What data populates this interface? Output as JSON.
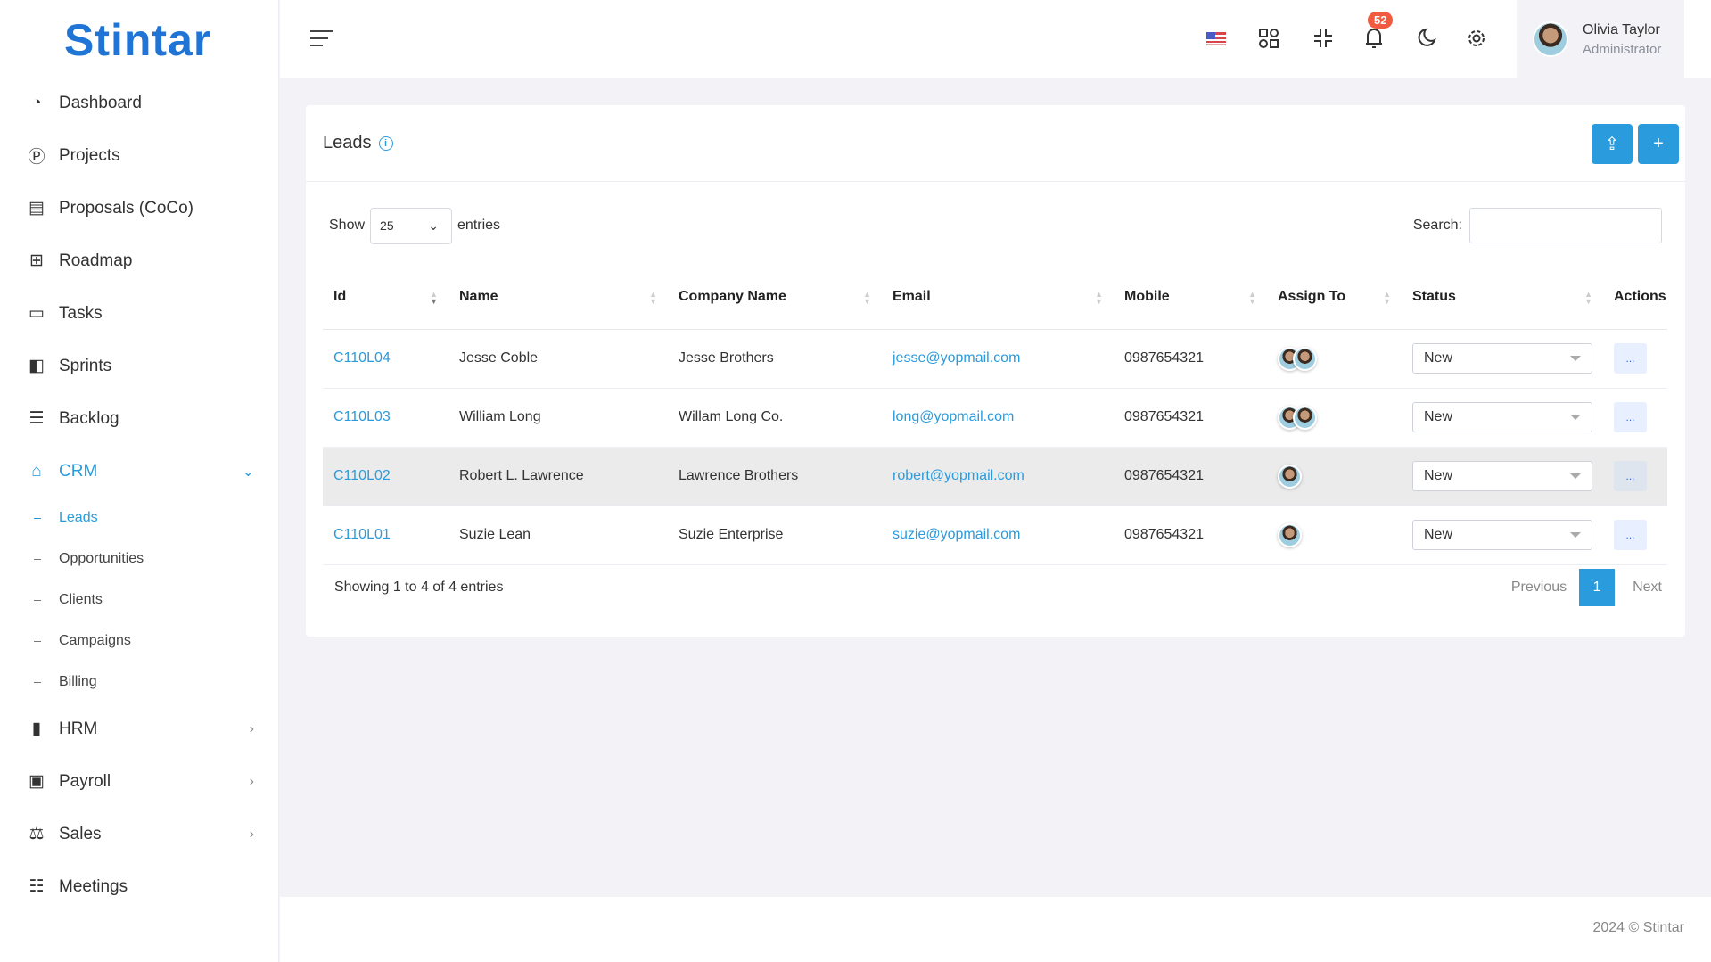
{
  "brand": {
    "name": "Stintar",
    "accent": "#2a9bdc"
  },
  "sidebar": {
    "items": [
      {
        "label": "Dashboard",
        "icon": "gauge-icon"
      },
      {
        "label": "Projects",
        "icon": "p-circle-icon"
      },
      {
        "label": "Proposals (CoCo)",
        "icon": "layout-icon"
      },
      {
        "label": "Roadmap",
        "icon": "sitemap-icon"
      },
      {
        "label": "Tasks",
        "icon": "ticket-icon"
      },
      {
        "label": "Sprints",
        "icon": "board-icon"
      },
      {
        "label": "Backlog",
        "icon": "list-check-icon"
      },
      {
        "label": "CRM",
        "icon": "crm-icon",
        "active": true,
        "expanded": true
      }
    ],
    "crm_sub": [
      "Leads",
      "Opportunities",
      "Clients",
      "Campaigns",
      "Billing"
    ],
    "items_after": [
      {
        "label": "HRM",
        "icon": "hrm-icon"
      },
      {
        "label": "Payroll",
        "icon": "payroll-icon"
      },
      {
        "label": "Sales",
        "icon": "scale-icon"
      },
      {
        "label": "Meetings",
        "icon": "people-icon"
      }
    ]
  },
  "header": {
    "notifications": "52",
    "user": {
      "name": "Olivia Taylor",
      "role": "Administrator"
    }
  },
  "card": {
    "title": "Leads",
    "show": "Show",
    "entries": "entries",
    "page_size": "25",
    "search_label": "Search:",
    "search_value": "",
    "columns": [
      "Id",
      "Name",
      "Company Name",
      "Email",
      "Mobile",
      "Assign To",
      "Status",
      "Actions"
    ],
    "rows": [
      {
        "id": "C110L04",
        "name": "Jesse Coble",
        "company": "Jesse Brothers",
        "email": "jesse@yopmail.com",
        "mobile": "0987654321",
        "assignees": 2,
        "status": "New"
      },
      {
        "id": "C110L03",
        "name": "William Long",
        "company": "Willam Long Co.",
        "email": "long@yopmail.com",
        "mobile": "0987654321",
        "assignees": 2,
        "status": "New"
      },
      {
        "id": "C110L02",
        "name": "Robert L. Lawrence",
        "company": "Lawrence Brothers",
        "email": "robert@yopmail.com",
        "mobile": "0987654321",
        "assignees": 1,
        "status": "New",
        "highlighted": true
      },
      {
        "id": "C110L01",
        "name": "Suzie Lean",
        "company": "Suzie Enterprise",
        "email": "suzie@yopmail.com",
        "mobile": "0987654321",
        "assignees": 1,
        "status": "New"
      }
    ],
    "summary": "Showing 1 to 4 of 4 entries",
    "prev": "Previous",
    "page": "1",
    "next": "Next",
    "actions_label": "..."
  },
  "footer": "2024 © Stintar"
}
